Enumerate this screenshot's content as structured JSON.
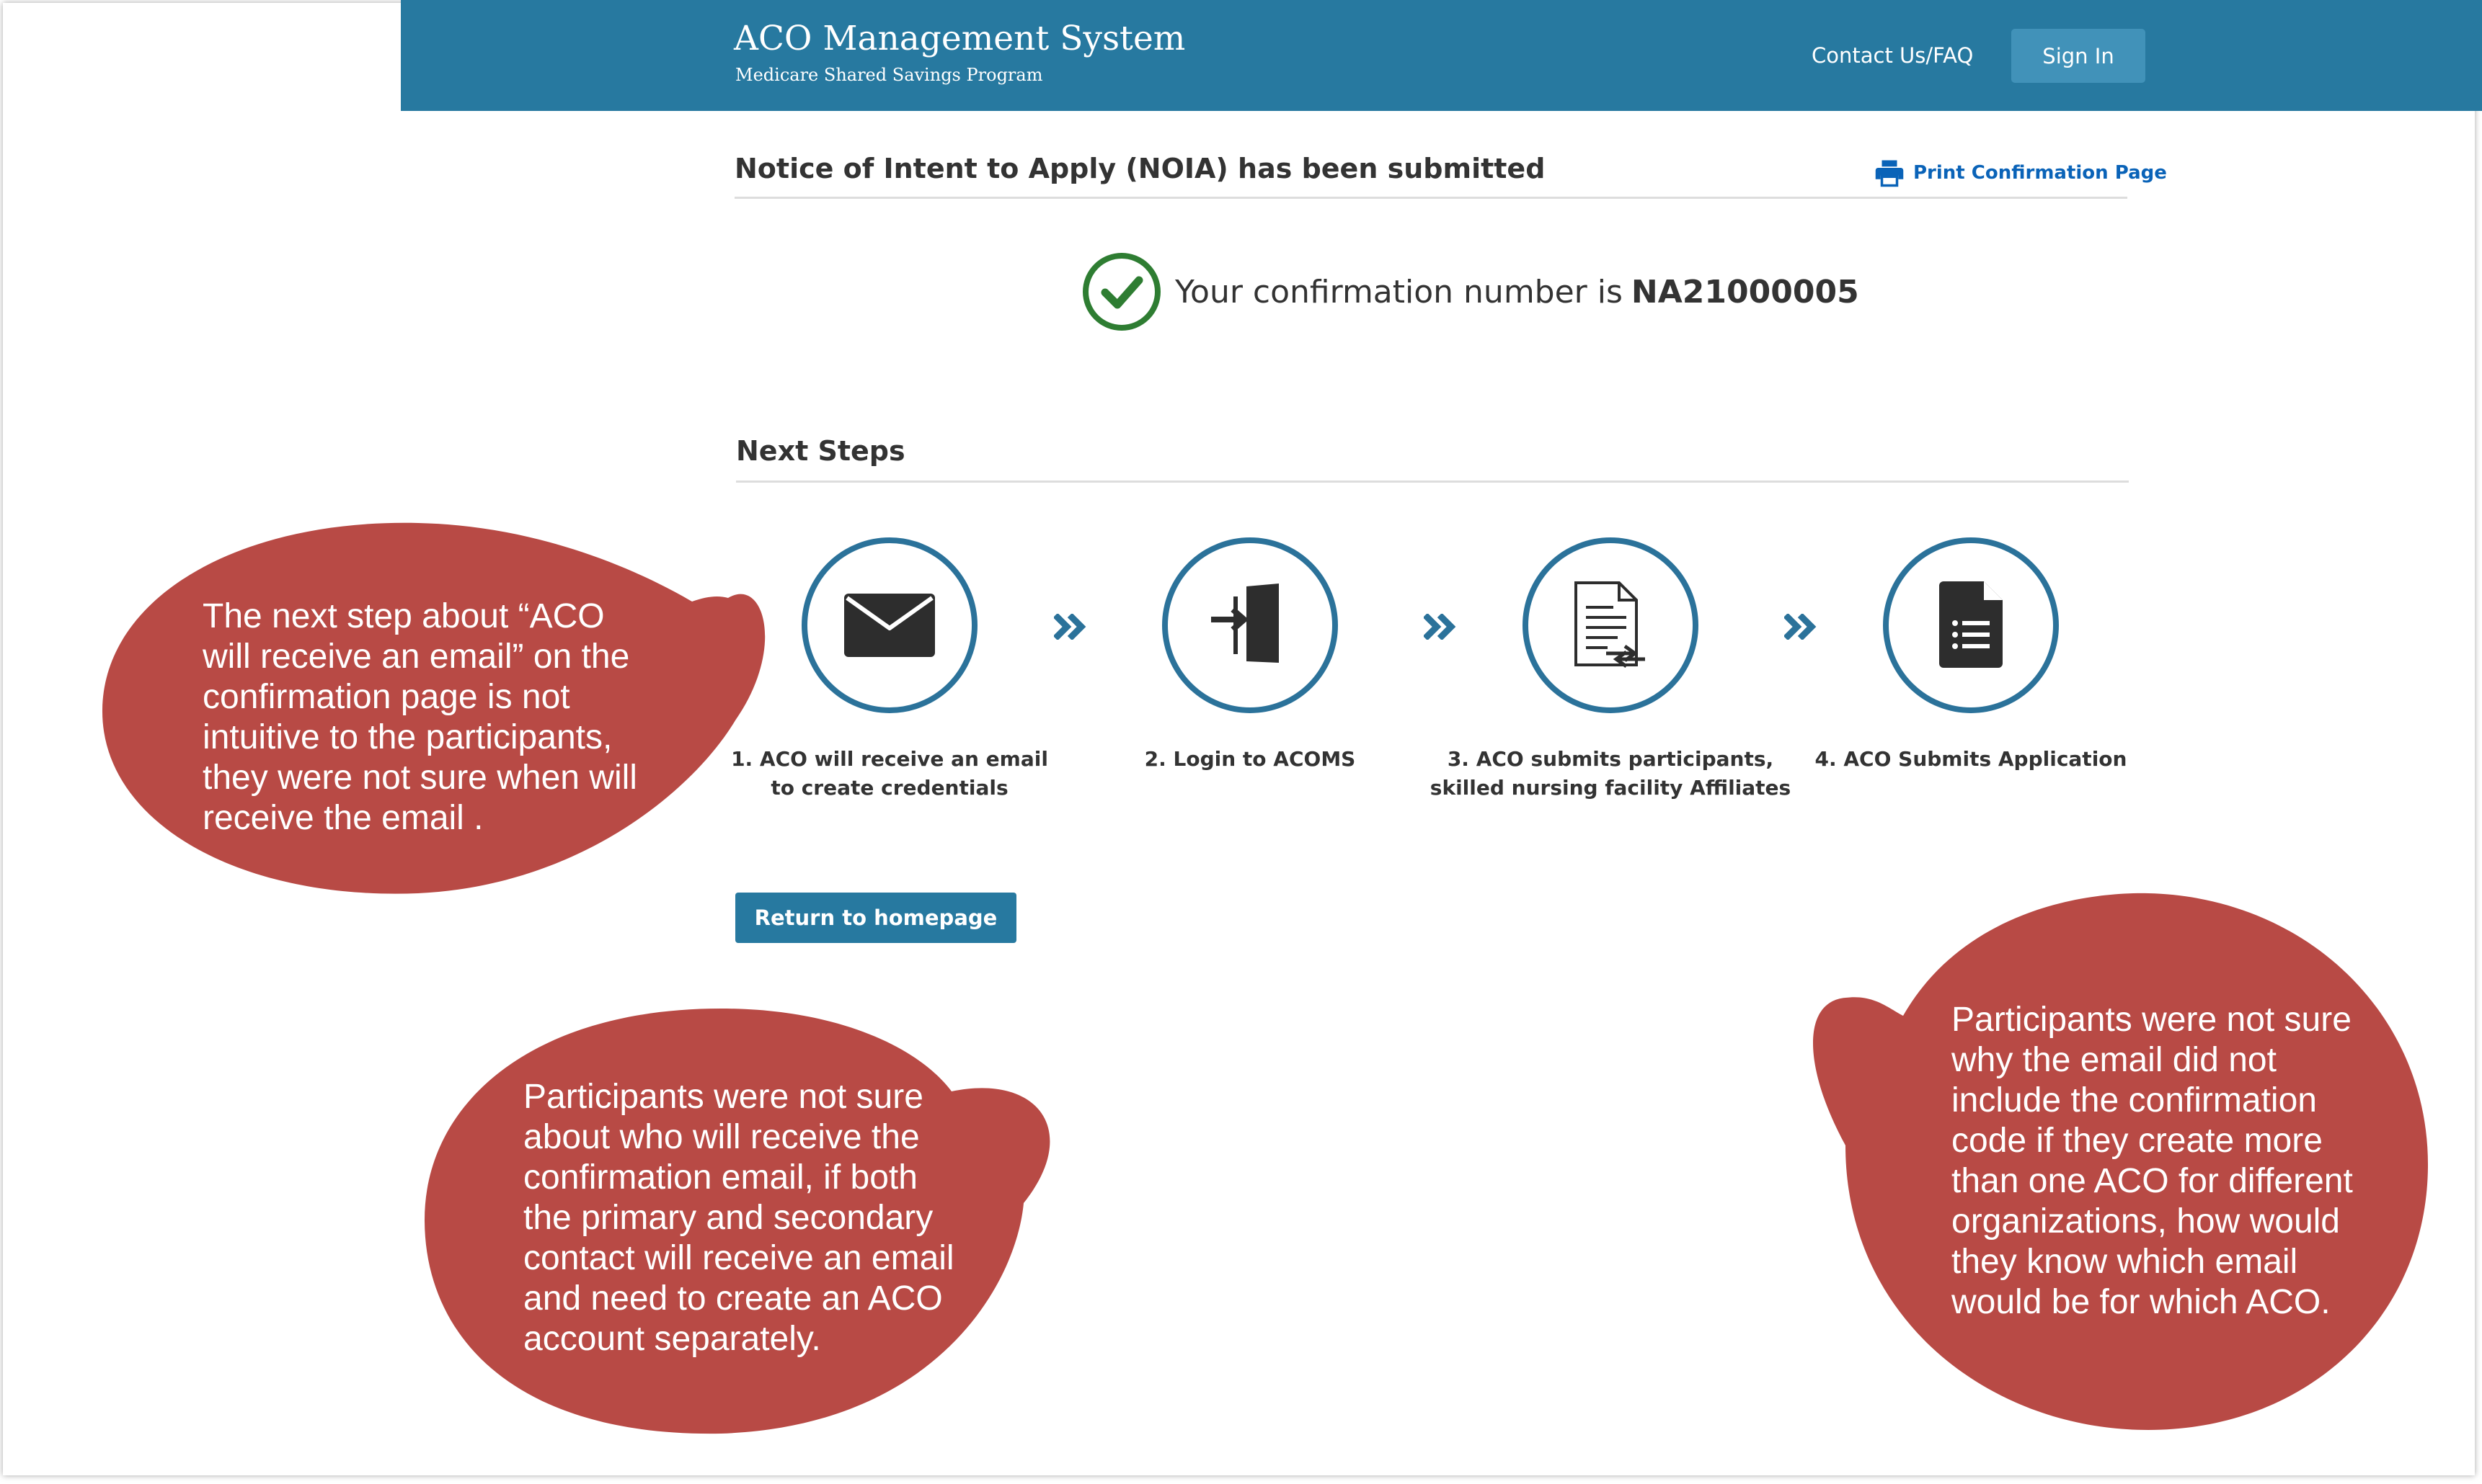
{
  "header": {
    "title": "ACO Management System",
    "subtitle": "Medicare Shared Savings Program",
    "contact_link": "Contact Us/FAQ",
    "sign_in": "Sign In"
  },
  "page": {
    "heading": "Notice of Intent to Apply (NOIA) has been submitted",
    "print_link": "Print Confirmation Page",
    "confirmation_text": "Your confirmation number is",
    "confirmation_number": "NA21000005"
  },
  "next_steps": {
    "heading": "Next Steps",
    "steps": [
      {
        "line1": "1. ACO will receive an email",
        "line2": "to create credentials",
        "icon": "envelope-icon"
      },
      {
        "line1": "2. Login to ACOMS",
        "line2": "",
        "icon": "login-icon"
      },
      {
        "line1": "3. ACO submits participants,",
        "line2": "skilled nursing facility Affiliates",
        "icon": "document-transfer-icon"
      },
      {
        "line1": "4. ACO Submits Application",
        "line2": "",
        "icon": "document-list-icon"
      }
    ],
    "return_button": "Return to homepage"
  },
  "annotations": {
    "color": "#b84a45",
    "callout_1": [
      "The next step about “ACO",
      "will receive an email” on the",
      "confirmation page is not",
      "intuitive to the participants,",
      "they were not sure when will",
      "receive the email ."
    ],
    "callout_2": [
      "Participants were not sure",
      "about who will receive the",
      "confirmation email, if both",
      "the primary and secondary",
      "contact will receive an email",
      "and need to create an ACO",
      "account separately."
    ],
    "callout_3": [
      "Participants were not sure",
      "why the email did not",
      "include the confirmation",
      "code if they create more",
      "than one ACO for different",
      "organizations, how would",
      "they know which email",
      "would be for which ACO."
    ]
  },
  "colors": {
    "header_bg": "#2779a0",
    "accent": "#2b729a",
    "link": "#0a63b8",
    "success": "#2e7d32"
  }
}
